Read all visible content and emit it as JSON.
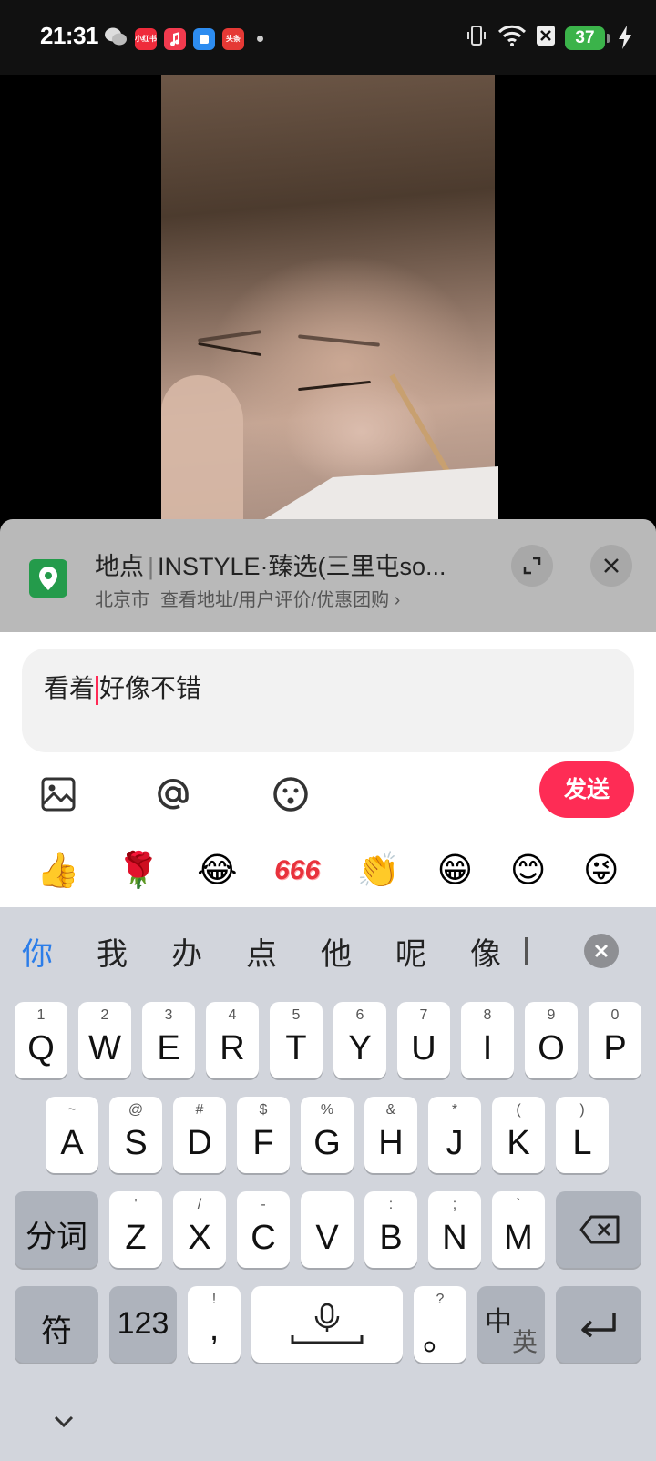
{
  "status_bar": {
    "time": "21:31",
    "battery": "37",
    "app_icons": [
      {
        "name": "wechat-icon",
        "text": ""
      },
      {
        "name": "xiaohongshu-icon",
        "text": "小红书"
      },
      {
        "name": "music-icon",
        "text": ""
      },
      {
        "name": "notes-icon",
        "text": ""
      },
      {
        "name": "toutiao-icon",
        "text": "头条"
      }
    ]
  },
  "location": {
    "tag": "地点",
    "name": "INSTYLE·臻选(三里屯so...",
    "city": "北京市",
    "link": "查看地址/用户评价/优惠团购 ›"
  },
  "comment": {
    "text_before_caret": "看着",
    "text_after_caret": "好像不错",
    "send_label": "发送"
  },
  "emojis": [
    "👍",
    "🌹",
    "😂",
    "666",
    "👏",
    "😁",
    "😊",
    "😜"
  ],
  "keyboard": {
    "candidates": [
      "你",
      "我",
      "办",
      "点",
      "他",
      "呢",
      "像"
    ],
    "row1": [
      {
        "k": "Q",
        "s": "1"
      },
      {
        "k": "W",
        "s": "2"
      },
      {
        "k": "E",
        "s": "3"
      },
      {
        "k": "R",
        "s": "4"
      },
      {
        "k": "T",
        "s": "5"
      },
      {
        "k": "Y",
        "s": "6"
      },
      {
        "k": "U",
        "s": "7"
      },
      {
        "k": "I",
        "s": "8"
      },
      {
        "k": "O",
        "s": "9"
      },
      {
        "k": "P",
        "s": "0"
      }
    ],
    "row2": [
      {
        "k": "A",
        "s": "~"
      },
      {
        "k": "S",
        "s": "@"
      },
      {
        "k": "D",
        "s": "#"
      },
      {
        "k": "F",
        "s": "$"
      },
      {
        "k": "G",
        "s": "%"
      },
      {
        "k": "H",
        "s": "&"
      },
      {
        "k": "J",
        "s": "*"
      },
      {
        "k": "K",
        "s": "("
      },
      {
        "k": "L",
        "s": ")"
      }
    ],
    "row3": [
      {
        "k": "Z",
        "s": "'"
      },
      {
        "k": "X",
        "s": "/"
      },
      {
        "k": "C",
        "s": "-"
      },
      {
        "k": "V",
        "s": "_"
      },
      {
        "k": "B",
        "s": ":"
      },
      {
        "k": "N",
        "s": ";"
      },
      {
        "k": "M",
        "s": "`"
      }
    ],
    "segment_label": "分词",
    "symbol_label": "符",
    "num_label": "123",
    "comma": ",",
    "comma_sub": "!",
    "period": "。",
    "period_sub": "?",
    "lang_zh": "中",
    "lang_en": "英"
  },
  "colors": {
    "accent": "#fe2c55",
    "candidate_highlight": "#2b7de9",
    "location_icon": "#249b4b"
  }
}
